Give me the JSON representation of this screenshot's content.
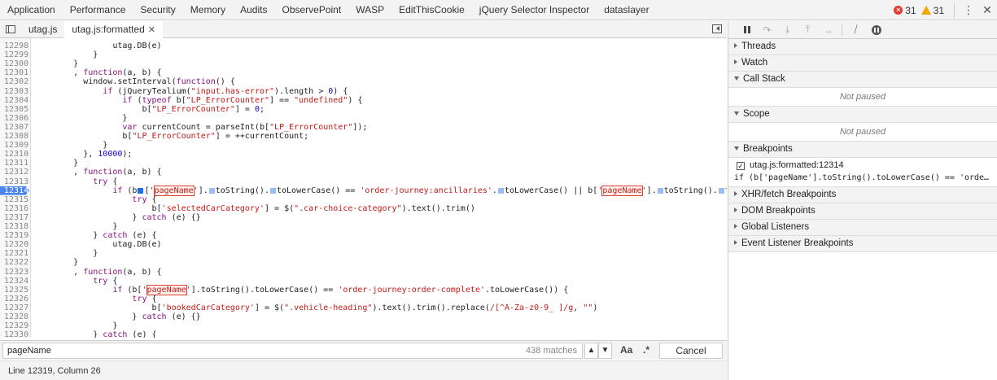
{
  "top_tabs": [
    "Application",
    "Performance",
    "Security",
    "Memory",
    "Audits",
    "ObservePoint",
    "WASP",
    "EditThisCookie",
    "jQuery Selector Inspector",
    "dataslayer"
  ],
  "counts": {
    "errors": "31",
    "warnings": "31"
  },
  "editor_tabs": [
    {
      "label": "utag.js"
    },
    {
      "label": "utag.js:formatted"
    }
  ],
  "colors": {
    "breakpoint": "#4a85f0",
    "error": "#e03c31",
    "warning": "#f2a600"
  },
  "code_lines": [
    {
      "n": "12298",
      "html": "                <span>utag.DB(e)</span>"
    },
    {
      "n": "12299",
      "html": "            }"
    },
    {
      "n": "12300",
      "html": "        }"
    },
    {
      "n": "12301",
      "html": "        , <span class=\"kw\">function</span>(a, b) {"
    },
    {
      "n": "12302",
      "html": "          window.setInterval(<span class=\"kw\">function</span>() {"
    },
    {
      "n": "12303",
      "html": "              <span class=\"kw\">if</span> (jQueryTealium(<span class=\"str\">\"input.has-error\"</span>).length > <span class=\"num\">0</span>) {"
    },
    {
      "n": "12304",
      "html": "                  <span class=\"kw\">if</span> (<span class=\"kw\">typeof</span> b[<span class=\"str\">\"LP_ErrorCounter\"</span>] == <span class=\"str\">\"undefined\"</span>) {"
    },
    {
      "n": "12305",
      "html": "                      b[<span class=\"str\">\"LP_ErrorCounter\"</span>] = <span class=\"num\">0</span>;"
    },
    {
      "n": "12306",
      "html": "                  }"
    },
    {
      "n": "12307",
      "html": "                  <span class=\"kw\">var</span> currentCount = parseInt(b[<span class=\"str\">\"LP_ErrorCounter\"</span>]);"
    },
    {
      "n": "12308",
      "html": "                  b[<span class=\"str\">\"LP_ErrorCounter\"</span>] = ++currentCount;"
    },
    {
      "n": "12309",
      "html": "              }"
    },
    {
      "n": "12310",
      "html": "          }, <span class=\"num\">10000</span>);"
    },
    {
      "n": "12311",
      "html": "        }"
    },
    {
      "n": "12312",
      "html": "        , <span class=\"kw\">function</span>(a, b) {"
    },
    {
      "n": "12313",
      "html": "            <span class=\"kw\">try</span> {"
    },
    {
      "n": "12314",
      "bp": true,
      "html": "                <span class=\"kw\">if</span> (b<span class=\"bpdot active\"></span>[<span class=\"str\">'<span class=\"hl\">pageName</span>'</span>].<span class=\"bpdot\"></span>toString().<span class=\"bpdot\"></span>toLowerCase() == <span class=\"str\">'order-journey:ancillaries'</span>.<span class=\"bpdot\"></span>toLowerCase() || b[<span class=\"str\">'<span class=\"hl\">pageName</span>'</span>].<span class=\"bpdot\"></span>toString().<span class=\"bpdot\"></span>toLowerCase()"
    },
    {
      "n": "12315",
      "html": "                    <span class=\"kw\">try</span> {"
    },
    {
      "n": "12316",
      "html": "                        b[<span class=\"str\">'selectedCarCategory'</span>] = $(<span class=\"str\">\".car-choice-category\"</span>).text().trim()"
    },
    {
      "n": "12317",
      "html": "                    } <span class=\"kw\">catch</span> (e) {}"
    },
    {
      "n": "12318",
      "html": "                }"
    },
    {
      "n": "12319",
      "html": "            } <span class=\"kw\">catch</span> (e) {"
    },
    {
      "n": "12320",
      "html": "                utag.DB(e)"
    },
    {
      "n": "12321",
      "html": "            }"
    },
    {
      "n": "12322",
      "html": "        }"
    },
    {
      "n": "12323",
      "html": "        , <span class=\"kw\">function</span>(a, b) {"
    },
    {
      "n": "12324",
      "html": "            <span class=\"kw\">try</span> {"
    },
    {
      "n": "12325",
      "html": "                <span class=\"kw\">if</span> (b[<span class=\"str\">'<span class=\"hl\">pageName</span>'</span>].toString().toLowerCase() == <span class=\"str\">'order-journey:order-complete'</span>.toLowerCase()) {"
    },
    {
      "n": "12326",
      "html": "                    <span class=\"kw\">try</span> {"
    },
    {
      "n": "12327",
      "html": "                        b[<span class=\"str\">'bookedCarCategory'</span>] = $(<span class=\"str\">\".vehicle-heading\"</span>).text().trim().replace(<span class=\"str\">/[^A-Za-z0-9_ ]/g</span>, <span class=\"str\">\"\"</span>)"
    },
    {
      "n": "12328",
      "html": "                    } <span class=\"kw\">catch</span> (e) {}"
    },
    {
      "n": "12329",
      "html": "                }"
    },
    {
      "n": "12330",
      "html": "            } <span class=\"kw\">catch</span> (e) {"
    }
  ],
  "search": {
    "value": "pageName",
    "matches": "438 matches",
    "case_label": "Aa",
    "regex_label": ".*",
    "cancel_label": "Cancel"
  },
  "status": "Line 12319, Column 26",
  "sidebar": {
    "threads": "Threads",
    "watch": "Watch",
    "call_stack": "Call Stack",
    "not_paused_1": "Not paused",
    "scope": "Scope",
    "not_paused_2": "Not paused",
    "breakpoints": "Breakpoints",
    "bp_name": "utag.js:formatted:12314",
    "bp_code": "if (b['pageName'].toString().toLowerCase() == 'order-journey:ancillaries'.toLowerCase()",
    "xhr": "XHR/fetch Breakpoints",
    "dom": "DOM Breakpoints",
    "global": "Global Listeners",
    "event": "Event Listener Breakpoints"
  }
}
